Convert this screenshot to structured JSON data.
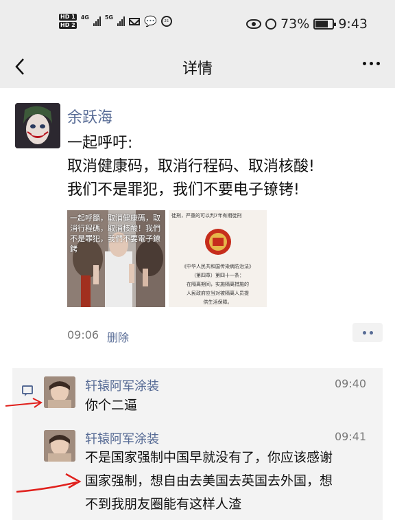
{
  "status_bar": {
    "hd1": "HD 1",
    "hd2": "HD 2",
    "net1": "4G",
    "net2": "5G",
    "badge": "2S",
    "battery": "73%",
    "time": "9:43"
  },
  "nav": {
    "title": "详情",
    "back_icon": "chevron-left-icon",
    "more_icon": "more-dots-icon"
  },
  "post": {
    "author": "余跃海",
    "lines": [
      "一起呼吁:",
      "取消健康码，取消行程码、取消核酸!",
      "我们不是罪犯，我们不要电子镣铐!"
    ],
    "image1_text": "一起呼籲，取消健康碼，取消行程碼，取消核酸！我們不是罪犯，我們不要電子鐐銬",
    "image2_header": "徒刑，严重的可以判7年有期徒刑",
    "image2_lines": [
      "《中华人民共和国传染病防治法》",
      "（第四章）第四十一条：",
      "在隔离期间，实施隔离措施的",
      "人民政府应当对被隔离人员提",
      "供生活保障。"
    ],
    "time": "09:06",
    "delete_label": "删除"
  },
  "comments": [
    {
      "name": "轩辕阿军涂装",
      "time": "09:40",
      "text": [
        "你个二逼"
      ]
    },
    {
      "name": "轩辕阿军涂装",
      "time": "09:41",
      "text": [
        "不是国家强制中国早就没有了，你应该感谢",
        "国家强制，想自由去美国去英国去外国，想",
        "不到我朋友圈能有这样人渣"
      ]
    }
  ],
  "colors": {
    "link": "#576b95",
    "bar": "#ededed",
    "annotation": "#e0201c"
  }
}
